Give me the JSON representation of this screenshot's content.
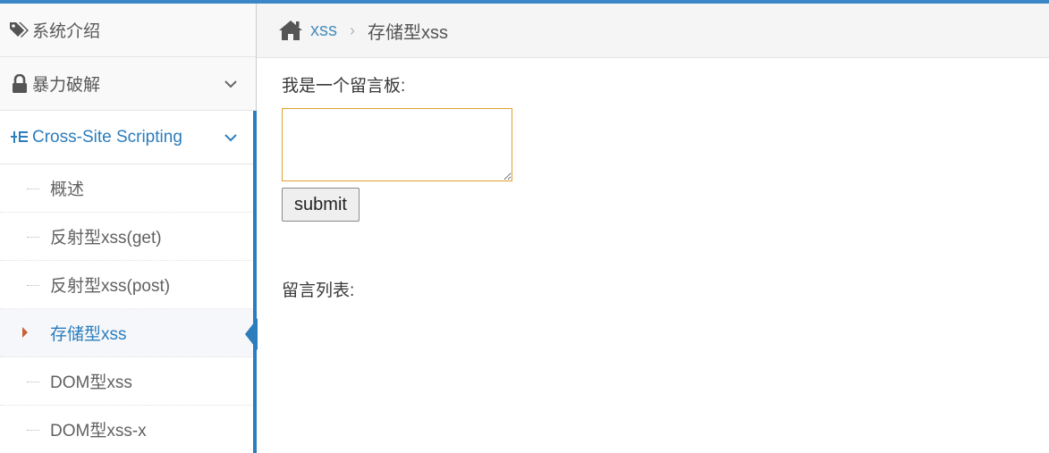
{
  "sidebar": {
    "items": [
      {
        "label": "系统介绍",
        "icon": "tags-icon"
      },
      {
        "label": "暴力破解",
        "icon": "lock-icon"
      },
      {
        "label": "Cross-Site Scripting",
        "icon": "list-tree-icon"
      }
    ],
    "subitems": [
      {
        "label": "概述"
      },
      {
        "label": "反射型xss(get)"
      },
      {
        "label": "反射型xss(post)"
      },
      {
        "label": "存储型xss"
      },
      {
        "label": "DOM型xss"
      },
      {
        "label": "DOM型xss-x"
      }
    ],
    "active_subitem": "存储型xss"
  },
  "breadcrumb": {
    "home_icon": "home-icon",
    "link": "xss",
    "separator": "›",
    "current": "存储型xss"
  },
  "main": {
    "prompt": "我是一个留言板:",
    "message_value": "",
    "submit_label": "submit",
    "list_title": "留言列表:"
  },
  "colors": {
    "accent": "#2b7dbc",
    "link": "#4c8fbd",
    "topbar": "#3a87c8",
    "caret": "#c86139",
    "input_border": "#e0a030"
  }
}
